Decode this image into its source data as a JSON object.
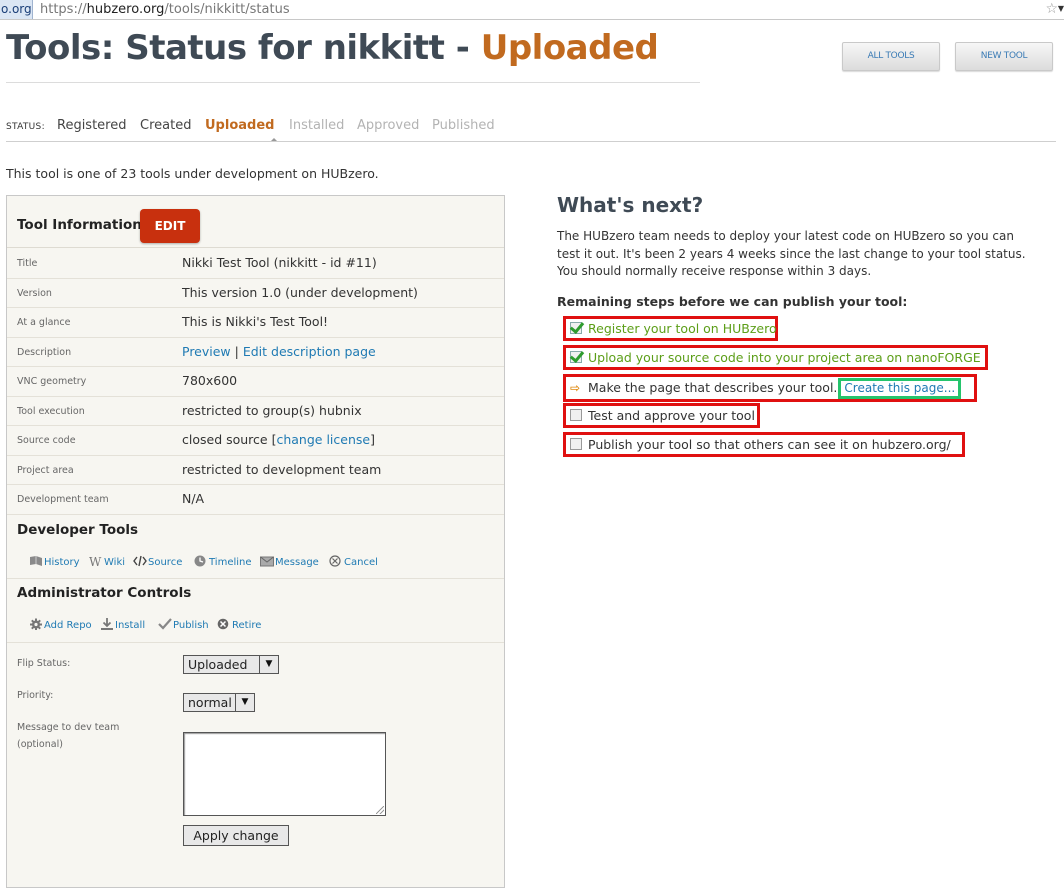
{
  "browser": {
    "domain_chip": "o.org",
    "url_prefix": "https://",
    "url_host": "hubzero.org",
    "url_path": "/tools/nikkitt/status"
  },
  "header": {
    "title_main": "Tools: Status for nikkitt - ",
    "title_status": "Uploaded",
    "buttons": {
      "all_tools": "ALL TOOLS",
      "new_tool": "NEW TOOL"
    }
  },
  "status": {
    "label": "STATUS:",
    "steps": [
      "Registered",
      "Created",
      "Uploaded",
      "Installed",
      "Approved",
      "Published"
    ],
    "current": "Uploaded"
  },
  "intro": "This tool is one of 23 tools under development on HUBzero.",
  "tool_info": {
    "heading": "Tool Information",
    "edit_label": "EDIT",
    "rows": [
      {
        "label": "Title",
        "value": "Nikki Test Tool (nikkitt - id #11)"
      },
      {
        "label": "Version",
        "value": "This version 1.0 (under development)"
      },
      {
        "label": "At a glance",
        "value": "This is Nikki's Test Tool!"
      },
      {
        "label": "Description",
        "link1": "Preview",
        "sep": " | ",
        "link2": "Edit description page"
      },
      {
        "label": "VNC geometry",
        "value": "780x600"
      },
      {
        "label": "Tool execution",
        "value": "restricted to group(s) hubnix"
      },
      {
        "label": "Source code",
        "prefix": "closed source [",
        "link": "change license",
        "suffix": "]"
      },
      {
        "label": "Project area",
        "value": "restricted to development team"
      },
      {
        "label": "Development team",
        "value": "N/A"
      }
    ]
  },
  "developer_tools": {
    "heading": "Developer Tools",
    "links": [
      {
        "label": "History",
        "icon": "history-icon"
      },
      {
        "label": "Wiki",
        "icon": "wiki-icon"
      },
      {
        "label": "Source",
        "icon": "source-icon"
      },
      {
        "label": "Timeline",
        "icon": "timeline-icon"
      },
      {
        "label": "Message",
        "icon": "message-icon"
      },
      {
        "label": "Cancel",
        "icon": "cancel-icon"
      }
    ]
  },
  "admin_controls": {
    "heading": "Administrator Controls",
    "links": [
      {
        "label": "Add Repo",
        "icon": "gear-icon"
      },
      {
        "label": "Install",
        "icon": "install-icon"
      },
      {
        "label": "Publish",
        "icon": "check-icon"
      },
      {
        "label": "Retire",
        "icon": "retire-icon"
      }
    ],
    "flip_status_label": "Flip Status:",
    "flip_status_value": "Uploaded",
    "priority_label": "Priority:",
    "priority_value": "normal",
    "message_label": "Message to dev team",
    "message_sublabel": "(optional)",
    "message_value": "",
    "apply_label": "Apply change"
  },
  "whats_next": {
    "title": "What's next?",
    "paragraph": "The HUBzero team needs to deploy your latest code on HUBzero so you can test it out. It's been 2 years 4 weeks since the last change to your tool status. You should normally receive response within 3 days.",
    "steps_heading": "Remaining steps before we can publish your tool:",
    "steps": [
      {
        "text": "Register your tool on HUBzero",
        "state": "done"
      },
      {
        "text": "Upload your source code into your project area on nanoFORGE",
        "state": "done"
      },
      {
        "text": "Make the page that describes your tool.",
        "state": "current",
        "link": "Create this page..."
      },
      {
        "text": "Test and approve your tool",
        "state": "todo"
      },
      {
        "text": "Publish your tool so that others can see it on hubzero.org/",
        "state": "todo"
      }
    ],
    "colors": {
      "highlight_box": "#e01010",
      "link_box": "#25c46c",
      "done_text": "#5c9e18"
    }
  }
}
